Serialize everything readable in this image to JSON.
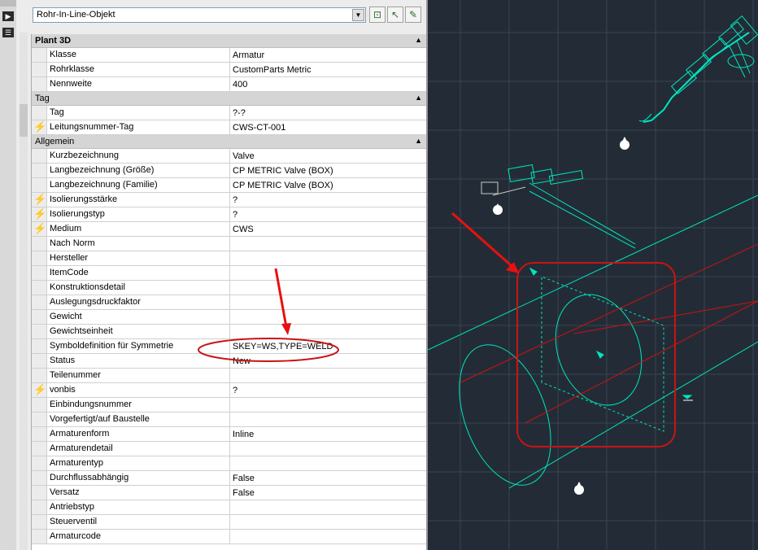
{
  "toolbar": {
    "object_type": "Rohr-In-Line-Objekt",
    "icons": [
      "quick-select-icon",
      "select-objects-icon",
      "toggle-pickadd-icon"
    ]
  },
  "categories": [
    {
      "label": "Plant 3D",
      "bold": true,
      "rows": [
        {
          "name": "Klasse",
          "value": "Armatur",
          "bolt": false
        },
        {
          "name": "Rohrklasse",
          "value": "CustomParts Metric",
          "bolt": false
        },
        {
          "name": "Nennweite",
          "value": "400",
          "bolt": false
        }
      ]
    },
    {
      "label": "Tag",
      "bold": false,
      "rows": [
        {
          "name": "Tag",
          "value": "?-?",
          "bolt": false
        },
        {
          "name": "Leitungsnummer-Tag",
          "value": "CWS-CT-001",
          "bolt": true
        }
      ]
    },
    {
      "label": "Allgemein",
      "bold": false,
      "rows": [
        {
          "name": "Kurzbezeichnung",
          "value": "Valve",
          "bolt": false
        },
        {
          "name": "Langbezeichnung (Größe)",
          "value": "CP METRIC Valve (BOX)",
          "bolt": false
        },
        {
          "name": "Langbezeichnung (Familie)",
          "value": "CP METRIC Valve (BOX)",
          "bolt": false
        },
        {
          "name": "Isolierungsstärke",
          "value": "?",
          "bolt": true
        },
        {
          "name": "Isolierungstyp",
          "value": "?",
          "bolt": true
        },
        {
          "name": "Medium",
          "value": "CWS",
          "bolt": true
        },
        {
          "name": "Nach Norm",
          "value": "",
          "bolt": false
        },
        {
          "name": "Hersteller",
          "value": "",
          "bolt": false
        },
        {
          "name": "ItemCode",
          "value": "",
          "bolt": false
        },
        {
          "name": "Konstruktionsdetail",
          "value": "",
          "bolt": false
        },
        {
          "name": "Auslegungsdruckfaktor",
          "value": "",
          "bolt": false
        },
        {
          "name": "Gewicht",
          "value": "",
          "bolt": false
        },
        {
          "name": "Gewichtseinheit",
          "value": "",
          "bolt": false
        },
        {
          "name": "Symboldefinition für Symmetrie",
          "value": "SKEY=WS,TYPE=WELD",
          "bolt": false
        },
        {
          "name": "Status",
          "value": "New",
          "bolt": false
        },
        {
          "name": "Teilenummer",
          "value": "",
          "bolt": false
        },
        {
          "name": "vonbis",
          "value": "?",
          "bolt": true
        },
        {
          "name": "Einbindungsnummer",
          "value": "",
          "bolt": false
        },
        {
          "name": "Vorgefertigt/auf Baustelle",
          "value": "",
          "bolt": false
        },
        {
          "name": "Armaturenform",
          "value": "Inline",
          "bolt": false
        },
        {
          "name": "Armaturendetail",
          "value": "",
          "bolt": false
        },
        {
          "name": "Armaturentyp",
          "value": "",
          "bolt": false
        },
        {
          "name": "Durchflussabhängig",
          "value": "False",
          "bolt": false
        },
        {
          "name": "Versatz",
          "value": "False",
          "bolt": false
        },
        {
          "name": "Antriebstyp",
          "value": "",
          "bolt": false
        },
        {
          "name": "Steuerventil",
          "value": "",
          "bolt": false
        },
        {
          "name": "Armaturcode",
          "value": "",
          "bolt": false
        }
      ]
    }
  ],
  "colors": {
    "cad_background": "#232c36",
    "cad_lines": "#00e5c0",
    "annotation": "#e01010",
    "bolt": "#e3a300"
  }
}
